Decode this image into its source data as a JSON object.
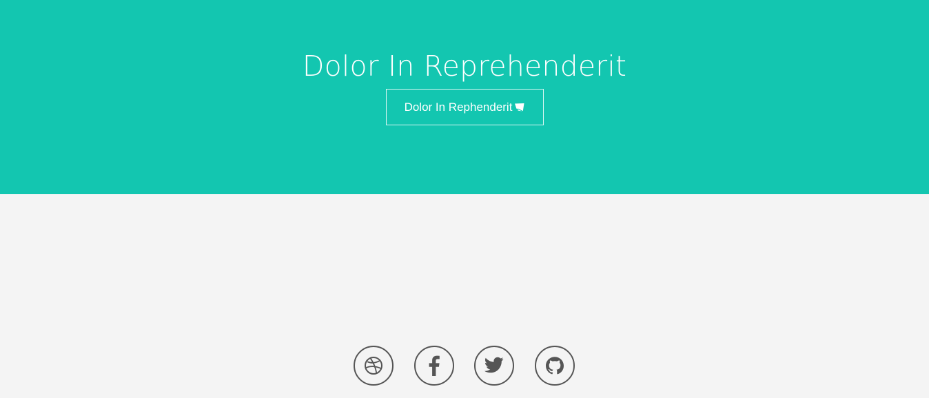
{
  "hero": {
    "title": "Dolor In Reprehenderit",
    "button_label": "Dolor In Rephenderit",
    "button_icon": "paper-plane-icon",
    "background_color": "#13c6b0",
    "text_color": "#ffffff"
  },
  "page": {
    "background_color": "#f4f4f4"
  },
  "social": [
    {
      "name": "dribbble",
      "icon": "dribbble-icon"
    },
    {
      "name": "facebook",
      "icon": "facebook-icon"
    },
    {
      "name": "twitter",
      "icon": "twitter-icon"
    },
    {
      "name": "github",
      "icon": "github-icon"
    }
  ],
  "social_icon_color": "#555555"
}
